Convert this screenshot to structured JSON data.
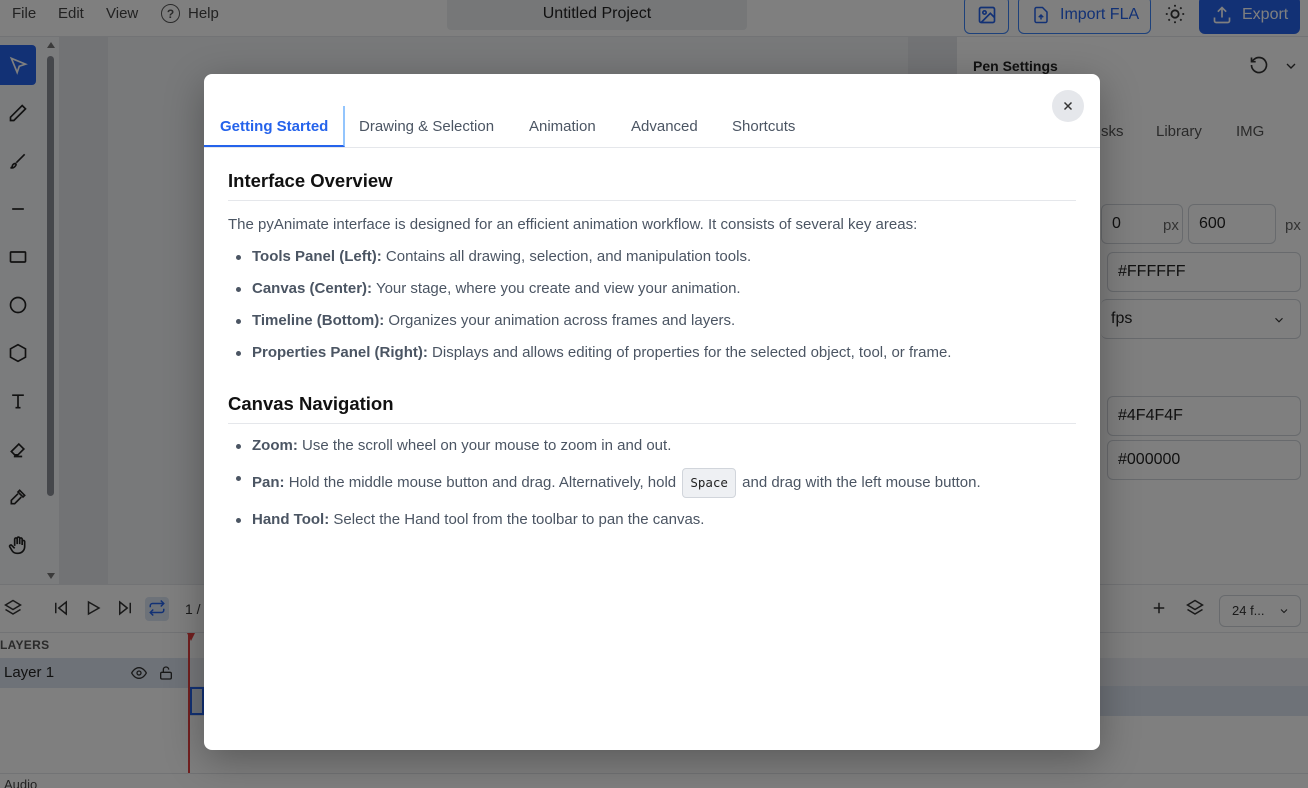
{
  "menu": {
    "file": "File",
    "edit": "Edit",
    "view": "View",
    "help": "Help"
  },
  "project": {
    "title": "Untitled Project"
  },
  "header": {
    "import_label": "Import FLA",
    "export_label": "Export"
  },
  "props": {
    "pen_settings": "Pen Settings",
    "tabs": [
      "sks",
      "Library",
      "IMG"
    ],
    "width_value": "0",
    "unit_px": "px",
    "height_value": "600",
    "bg_color": "#FFFFFF",
    "fps": "fps",
    "stroke_color": "#4F4F4F",
    "fill_color": "#000000"
  },
  "timeline": {
    "frame_counter": "1 /",
    "fps_select": "24 f...",
    "layers_label": "LAYERS",
    "layer_name": "Layer 1",
    "audio_label": "Audio"
  },
  "modal": {
    "tabs": [
      "Getting Started",
      "Drawing & Selection",
      "Animation",
      "Advanced",
      "Shortcuts"
    ],
    "section1": {
      "title": "Interface Overview",
      "intro": "The pyAnimate interface is designed for an efficient animation workflow. It consists of several key areas:",
      "items": [
        {
          "term": "Tools Panel (Left):",
          "desc": "Contains all drawing, selection, and manipulation tools."
        },
        {
          "term": "Canvas (Center):",
          "desc": "Your stage, where you create and view your animation."
        },
        {
          "term": "Timeline (Bottom):",
          "desc": "Organizes your animation across frames and layers."
        },
        {
          "term": "Properties Panel (Right):",
          "desc": "Displays and allows editing of properties for the selected object, tool, or frame."
        }
      ]
    },
    "section2": {
      "title": "Canvas Navigation",
      "zoom_term": "Zoom:",
      "zoom_desc": "Use the scroll wheel on your mouse to zoom in and out.",
      "pan_term": "Pan:",
      "pan_desc_before": "Hold the middle mouse button and drag. Alternatively, hold",
      "pan_key": "Space",
      "pan_desc_after": "and drag with the left mouse button.",
      "hand_term": "Hand Tool:",
      "hand_desc": "Select the Hand tool from the toolbar to pan the canvas."
    }
  }
}
